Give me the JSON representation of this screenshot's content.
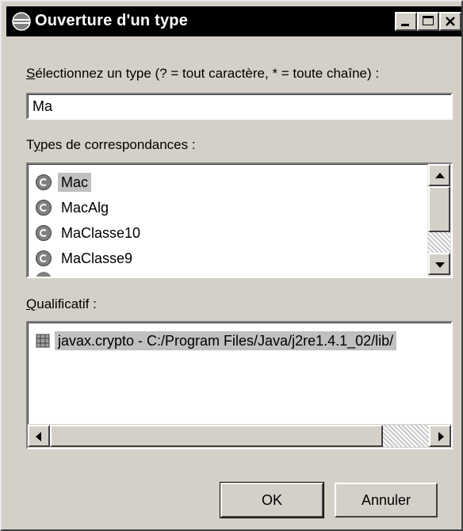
{
  "window": {
    "title": "Ouverture d'un type"
  },
  "search": {
    "label_mnemonic": "S",
    "label_rest": "électionnez un type (? = tout caractère, * = toute chaîne) :",
    "value": "Ma"
  },
  "matches": {
    "label_prefix": "T",
    "label_mnemonic": "y",
    "label_rest": "pes de correspondances :",
    "items": [
      {
        "label": "Mac",
        "icon": "class-icon",
        "selected": true
      },
      {
        "label": "MacAlg",
        "icon": "class-icon",
        "selected": false
      },
      {
        "label": "MaClasse10",
        "icon": "class-icon",
        "selected": false
      },
      {
        "label": "MaClasse9",
        "icon": "class-icon",
        "selected": false
      }
    ]
  },
  "qualifier": {
    "label_mnemonic": "Q",
    "label_rest": "ualificatif :",
    "items": [
      {
        "label": "javax.crypto - C:/Program Files/Java/j2re1.4.1_02/lib/",
        "icon": "package-icon",
        "selected": true
      }
    ]
  },
  "buttons": {
    "ok": "OK",
    "cancel": "Annuler"
  }
}
